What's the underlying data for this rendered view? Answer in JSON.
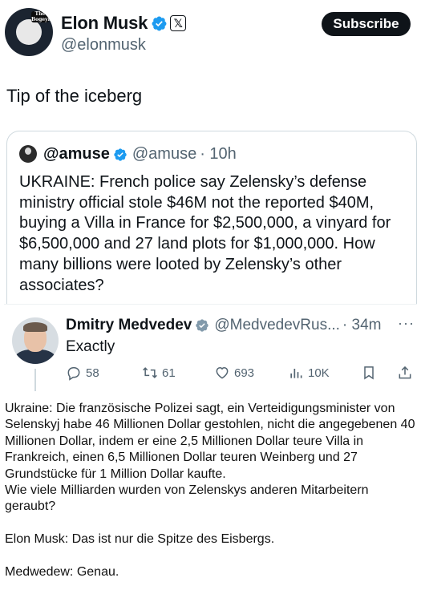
{
  "tweet": {
    "author_name": "Elon Musk",
    "handle": "@elonmusk",
    "subscribe_label": "Subscribe",
    "text": "Tip of the iceberg",
    "avatar_tag": "The Bogeyman"
  },
  "quote": {
    "author_name": "@amuse",
    "handle": "@amuse",
    "time": "· 10h",
    "text": "UKRAINE: French police say Zelensky’s defense ministry official stole $46M not the reported $40M, buying a Villa in France for $2,500,000, a vinyard for $6,500,000 and 27 land plots for $1,000,000. How many billions were looted by Zelensky’s other associates?"
  },
  "reply": {
    "author_name": "Dmitry Medvedev",
    "handle": "@MedvedevRus...",
    "time": "· 34m",
    "more": "···",
    "text": "Exactly",
    "replies": "58",
    "reposts": "61",
    "likes": "693",
    "views": "10K"
  },
  "caption": {
    "paragraph1": "Ukraine: Die französische Polizei sagt, ein Verteidigungsminister von Selenskyj habe 46 Millionen Dollar gestohlen, nicht die angegebenen 40 Millionen Dollar, indem er eine 2,5 Millionen Dollar teure Villa in Frankreich, einen 6,5 Millionen Dollar teuren Weinberg und 27 Grundstücke für 1 Million Dollar kaufte.",
    "paragraph2": "Wie viele Milliarden wurden von Zelenskys anderen Mitarbeitern geraubt?",
    "paragraph3": "Elon Musk: Das ist nur die Spitze des Eisbergs.",
    "paragraph4": "Medwedew: Genau."
  },
  "colors": {
    "verified_blue": "#1d9bf0",
    "text_primary": "#0f1419",
    "text_secondary": "#536471",
    "border": "#cfd9de"
  },
  "icons": [
    "verified-badge-icon",
    "x-logo-icon",
    "reply-icon",
    "repost-icon",
    "like-icon",
    "views-icon",
    "bookmark-icon",
    "share-icon",
    "more-icon"
  ]
}
